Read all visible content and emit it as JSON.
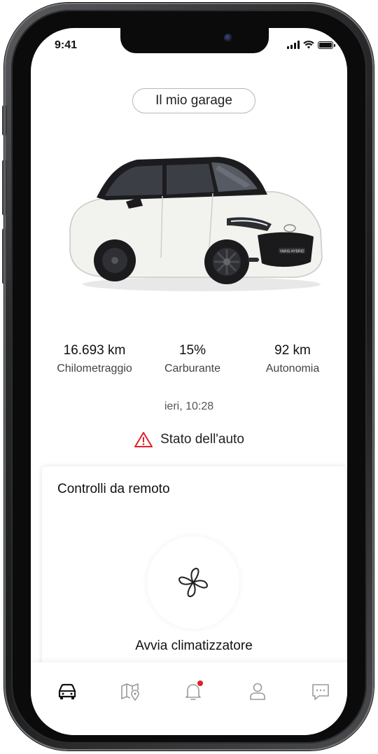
{
  "status_bar": {
    "time": "9:41"
  },
  "header": {
    "garage_label": "Il mio garage"
  },
  "car": {
    "model_badge": "YARIS HYBRID"
  },
  "stats": [
    {
      "value": "16.693 km",
      "label": "Chilometraggio"
    },
    {
      "value": "15%",
      "label": "Carburante"
    },
    {
      "value": "92 km",
      "label": "Autonomia"
    }
  ],
  "last_update": "ieri, 10:28",
  "car_status": {
    "label": "Stato dell'auto",
    "icon": "warning-icon"
  },
  "remote_controls": {
    "title": "Controlli da remoto",
    "action_label": "Avvia climatizzatore",
    "action_icon": "fan-icon"
  },
  "bottom_nav": {
    "items": [
      {
        "icon": "car-icon",
        "active": true
      },
      {
        "icon": "map-pin-icon",
        "active": false
      },
      {
        "icon": "bell-icon",
        "active": false,
        "badge": true
      },
      {
        "icon": "user-icon",
        "active": false
      },
      {
        "icon": "chat-icon",
        "active": false
      }
    ]
  },
  "colors": {
    "accent": "#e0202a",
    "text": "#111111",
    "muted": "#555555",
    "inactive_icon": "#9a9a9a",
    "car_body": "#f2f2ee"
  }
}
